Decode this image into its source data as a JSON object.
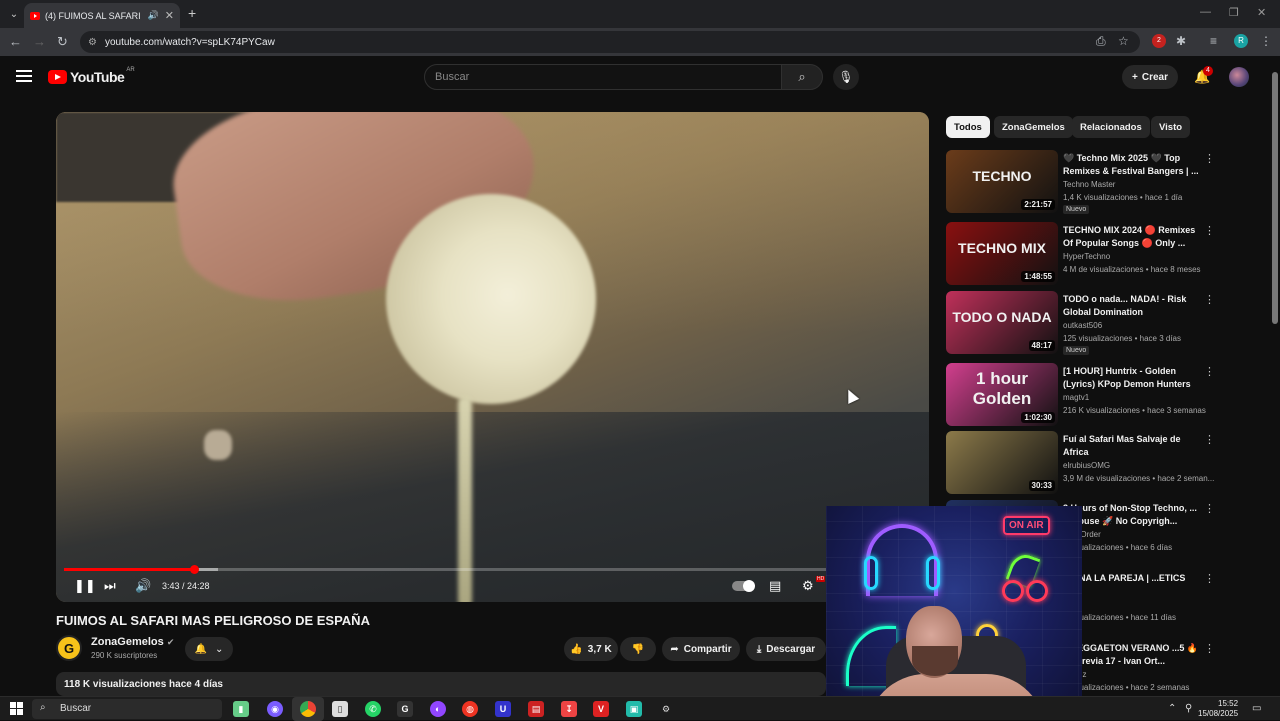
{
  "browser": {
    "tab_title": "(4) FUIMOS AL SAFARI MA",
    "url": "youtube.com/watch?v=spLK74PYCaw",
    "profile_initial": "R",
    "ext_badge": "2"
  },
  "header": {
    "logo_text": "YouTube",
    "region": "AR",
    "search_placeholder": "Buscar",
    "create_label": "Crear",
    "notif_count": "4"
  },
  "player": {
    "time": "3:43 / 24:28",
    "played_fraction": 0.152,
    "buffered_fraction": 0.18,
    "hd_badge": "HD"
  },
  "video": {
    "title": "FUIMOS AL SAFARI MAS PELIGROSO DE ESPAÑA",
    "channel": "ZonaGemelos",
    "subscribers": "290 K suscriptores",
    "likes": "3,7 K",
    "share_label": "Compartir",
    "download_label": "Descargar",
    "views_date": "118 K visualizaciones  hace 4 días"
  },
  "chips": [
    "Todos",
    "ZonaGemelos",
    "Relacionados",
    "Visto"
  ],
  "sidebar": {
    "items": [
      {
        "title": "🖤 Techno Mix 2025 🖤 Top Remixes & Festival Bangers | ...",
        "channel": "Techno Master",
        "meta": "1,4 K visualizaciones • hace 1 día",
        "badge": "Nuevo",
        "duration": "2:21:57",
        "thumb_text": "TECHNO",
        "thumb_color": "#6b3c1a"
      },
      {
        "title": "TECHNO MIX 2024 🔴 Remixes Of Popular Songs 🔴 Only ...",
        "channel": "HyperTechno",
        "meta": "4 M de visualizaciones • hace 8 meses",
        "badge": "",
        "duration": "1:48:55",
        "thumb_text": "TECHNO MIX",
        "thumb_color": "#8a1010"
      },
      {
        "title": "TODO o nada... NADA! - Risk Global Domination",
        "channel": "outkast506",
        "meta": "125 visualizaciones • hace 3 días",
        "badge": "Nuevo",
        "duration": "48:17",
        "thumb_text": "TODO O NADA",
        "thumb_color": "#c0305a"
      },
      {
        "title": "[1 HOUR] Huntrix - Golden (Lyrics) KPop Demon Hunters",
        "channel": "magtv1",
        "meta": "216 K visualizaciones • hace 3 semanas",
        "badge": "",
        "duration": "1:02:30",
        "thumb_text": "1 hour Golden",
        "thumb_color": "#d23f8e"
      },
      {
        "title": "Fuí al Safari Mas Salvaje de Africa",
        "channel": "elrubiusOMG",
        "meta": "3,9 M de visualizaciones • hace 2 seman...",
        "badge": "",
        "duration": "30:33",
        "thumb_text": "",
        "thumb_color": "#8c7a4a"
      },
      {
        "title": "3 Hours of Non-Stop Techno, ... & House 🚀 No Copyrigh...",
        "channel": "...ek Order",
        "meta": "...visualizaciones • hace 6 días",
        "badge": "...vo",
        "duration": "",
        "thumb_text": "",
        "thumb_color": "#203060"
      },
      {
        "title": "...VINA LA PAREJA | ...ETICS",
        "channel": "...ics",
        "meta": "...visualizaciones • hace 11 días",
        "badge": "",
        "duration": "",
        "thumb_text": "",
        "thumb_color": "#303040"
      },
      {
        "title": "...REGGAETON VERANO ...5 🔥 La Previa 17 - Ivan Ort...",
        "channel": "...Ortiz",
        "meta": "...visualizaciones • hace 2 semanas",
        "badge": "",
        "duration": "",
        "thumb_text": "",
        "thumb_color": "#402030"
      }
    ]
  },
  "webcam": {
    "on_air": "ON AIR"
  },
  "taskbar": {
    "search_label": "Buscar",
    "time": "15:52",
    "date": "15/08/2025"
  },
  "colors": {
    "accent": "#ff0000",
    "bg": "#0f0f0f",
    "pill": "#272727"
  }
}
